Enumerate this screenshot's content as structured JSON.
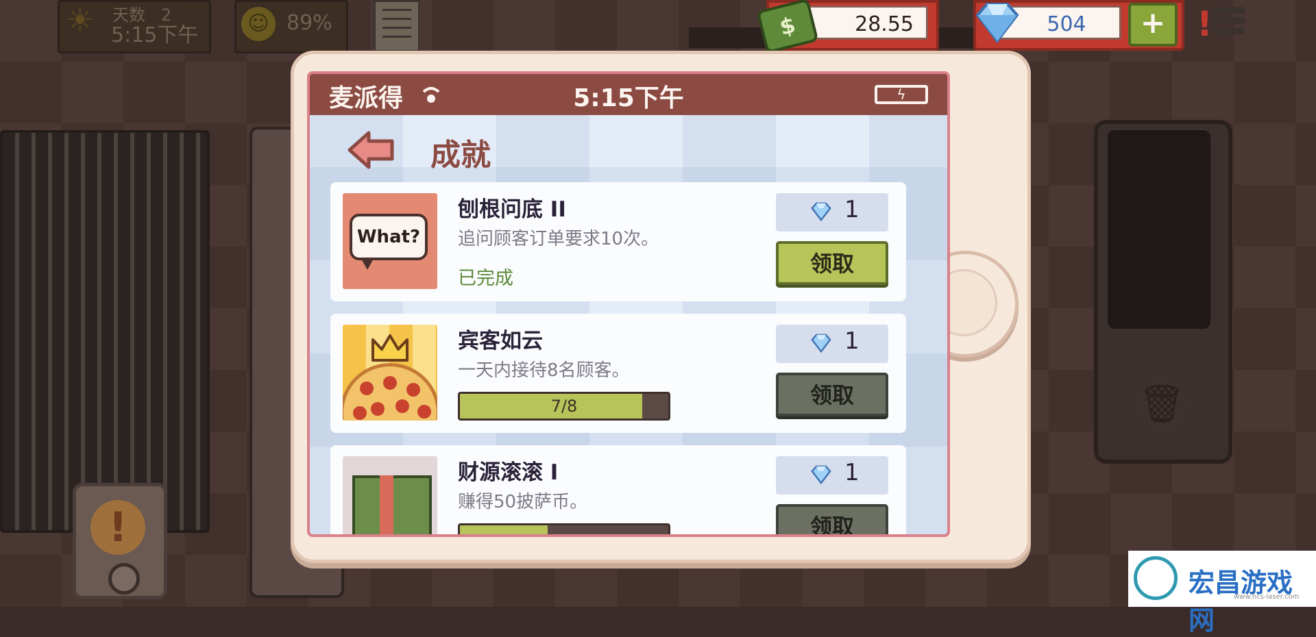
{
  "hud": {
    "day_label": "天数",
    "day_number": "2",
    "time": "5:15下午",
    "mood_percent": "89%",
    "money": "28.55",
    "money_icon_symbol": "$",
    "gems": "504",
    "plus_label": "+"
  },
  "phone": {
    "app_name": "麦派得",
    "clock": "5:15下午",
    "page_title": "成就"
  },
  "achievements": [
    {
      "title": "刨根问底 II",
      "description": "追问顾客订单要求10次。",
      "status": "已完成",
      "thumb_text": "What?",
      "reward": "1",
      "claim_label": "领取",
      "claimable": true
    },
    {
      "title": "宾客如云",
      "description": "一天内接待8名顾客。",
      "progress_label": "7/8",
      "progress_fraction": 0.875,
      "reward": "1",
      "claim_label": "领取",
      "claimable": false
    },
    {
      "title": "财源滚滚 I",
      "description": "赚得50披萨币。",
      "progress_fraction": 0.42,
      "reward": "1",
      "claim_label": "领取",
      "claimable": false
    }
  ],
  "watermark": {
    "name": "宏昌游戏网",
    "url": "www.hcs-laser.com"
  },
  "colors": {
    "status_bar": "#8b4a42",
    "claim_active": "#b7c45a",
    "claim_disabled": "#6b7063",
    "progress_fill": "#b7c45a",
    "hud_red": "#c23a2e"
  },
  "icons": [
    "sun-icon",
    "mood-face-icon",
    "receipt-icon",
    "money-icon",
    "gem-icon",
    "plus-icon",
    "alert-icon",
    "menu-icon",
    "wifi-icon",
    "battery-icon",
    "back-arrow-icon",
    "pizza-crown-icon",
    "cash-stack-icon",
    "trash-icon"
  ]
}
